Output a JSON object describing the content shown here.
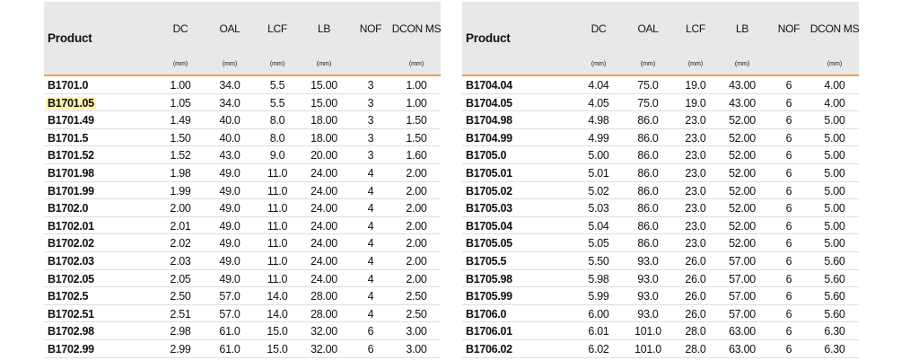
{
  "columns": [
    {
      "label": "DC",
      "unit": "(mm)"
    },
    {
      "label": "OAL",
      "unit": "(mm)"
    },
    {
      "label": "LCF",
      "unit": "(mm)"
    },
    {
      "label": "LB",
      "unit": "(mm)"
    },
    {
      "label": "NOF",
      "unit": ""
    },
    {
      "label": "DCON MS",
      "unit": "(mm)"
    }
  ],
  "product_header": "Product",
  "highlight": "B1701.05",
  "tables": [
    {
      "rows": [
        [
          "B1701.0",
          "1.00",
          "34.0",
          "5.5",
          "15.00",
          "3",
          "1.00"
        ],
        [
          "B1701.05",
          "1.05",
          "34.0",
          "5.5",
          "15.00",
          "3",
          "1.00"
        ],
        [
          "B1701.49",
          "1.49",
          "40.0",
          "8.0",
          "18.00",
          "3",
          "1.50"
        ],
        [
          "B1701.5",
          "1.50",
          "40.0",
          "8.0",
          "18.00",
          "3",
          "1.50"
        ],
        [
          "B1701.52",
          "1.52",
          "43.0",
          "9.0",
          "20.00",
          "3",
          "1.60"
        ],
        [
          "B1701.98",
          "1.98",
          "49.0",
          "11.0",
          "24.00",
          "4",
          "2.00"
        ],
        [
          "B1701.99",
          "1.99",
          "49.0",
          "11.0",
          "24.00",
          "4",
          "2.00"
        ],
        [
          "B1702.0",
          "2.00",
          "49.0",
          "11.0",
          "24.00",
          "4",
          "2.00"
        ],
        [
          "B1702.01",
          "2.01",
          "49.0",
          "11.0",
          "24.00",
          "4",
          "2.00"
        ],
        [
          "B1702.02",
          "2.02",
          "49.0",
          "11.0",
          "24.00",
          "4",
          "2.00"
        ],
        [
          "B1702.03",
          "2.03",
          "49.0",
          "11.0",
          "24.00",
          "4",
          "2.00"
        ],
        [
          "B1702.05",
          "2.05",
          "49.0",
          "11.0",
          "24.00",
          "4",
          "2.00"
        ],
        [
          "B1702.5",
          "2.50",
          "57.0",
          "14.0",
          "28.00",
          "4",
          "2.50"
        ],
        [
          "B1702.51",
          "2.51",
          "57.0",
          "14.0",
          "28.00",
          "4",
          "2.50"
        ],
        [
          "B1702.98",
          "2.98",
          "61.0",
          "15.0",
          "32.00",
          "6",
          "3.00"
        ],
        [
          "B1702.99",
          "2.99",
          "61.0",
          "15.0",
          "32.00",
          "6",
          "3.00"
        ]
      ]
    },
    {
      "rows": [
        [
          "B1704.04",
          "4.04",
          "75.0",
          "19.0",
          "43.00",
          "6",
          "4.00"
        ],
        [
          "B1704.05",
          "4.05",
          "75.0",
          "19.0",
          "43.00",
          "6",
          "4.00"
        ],
        [
          "B1704.98",
          "4.98",
          "86.0",
          "23.0",
          "52.00",
          "6",
          "5.00"
        ],
        [
          "B1704.99",
          "4.99",
          "86.0",
          "23.0",
          "52.00",
          "6",
          "5.00"
        ],
        [
          "B1705.0",
          "5.00",
          "86.0",
          "23.0",
          "52.00",
          "6",
          "5.00"
        ],
        [
          "B1705.01",
          "5.01",
          "86.0",
          "23.0",
          "52.00",
          "6",
          "5.00"
        ],
        [
          "B1705.02",
          "5.02",
          "86.0",
          "23.0",
          "52.00",
          "6",
          "5.00"
        ],
        [
          "B1705.03",
          "5.03",
          "86.0",
          "23.0",
          "52.00",
          "6",
          "5.00"
        ],
        [
          "B1705.04",
          "5.04",
          "86.0",
          "23.0",
          "52.00",
          "6",
          "5.00"
        ],
        [
          "B1705.05",
          "5.05",
          "86.0",
          "23.0",
          "52.00",
          "6",
          "5.00"
        ],
        [
          "B1705.5",
          "5.50",
          "93.0",
          "26.0",
          "57.00",
          "6",
          "5.60"
        ],
        [
          "B1705.98",
          "5.98",
          "93.0",
          "26.0",
          "57.00",
          "6",
          "5.60"
        ],
        [
          "B1705.99",
          "5.99",
          "93.0",
          "26.0",
          "57.00",
          "6",
          "5.60"
        ],
        [
          "B1706.0",
          "6.00",
          "93.0",
          "26.0",
          "57.00",
          "6",
          "5.60"
        ],
        [
          "B1706.01",
          "6.01",
          "101.0",
          "28.0",
          "63.00",
          "6",
          "6.30"
        ],
        [
          "B1706.02",
          "6.02",
          "101.0",
          "28.0",
          "63.00",
          "6",
          "6.30"
        ]
      ]
    }
  ]
}
